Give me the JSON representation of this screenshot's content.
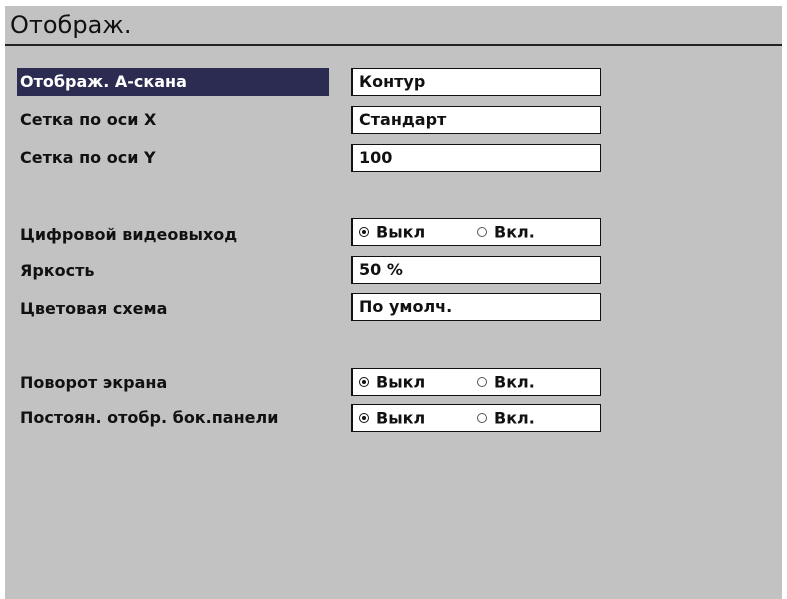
{
  "title": "Отображ.",
  "settings": {
    "ascan_display": {
      "label": "Отображ. А-скана",
      "value": "Контур"
    },
    "x_grid": {
      "label": "Сетка по оси X",
      "value": "Стандарт"
    },
    "y_grid": {
      "label": "Сетка по оси Y",
      "value": "100"
    },
    "digital_video_out": {
      "label": "Цифровой видеовыход",
      "options": [
        "Выкл",
        "Вкл."
      ],
      "selected": "Выкл"
    },
    "brightness": {
      "label": "Яркость",
      "value": "50 %"
    },
    "color_scheme": {
      "label": "Цветовая схема",
      "value": "По умолч."
    },
    "screen_rotation": {
      "label": "Поворот экрана",
      "options": [
        "Выкл",
        "Вкл."
      ],
      "selected": "Выкл"
    },
    "side_panel_always": {
      "label": "Постоян. отобр. бок.панели",
      "options": [
        "Выкл",
        "Вкл."
      ],
      "selected": "Выкл"
    }
  },
  "colors": {
    "background": "#c2c2c2",
    "selection": "#2c2c52",
    "field": "#ffffff",
    "text": "#111111"
  },
  "icons": {
    "radio_on": "radio-selected-icon",
    "radio_off": "radio-unselected-icon"
  }
}
